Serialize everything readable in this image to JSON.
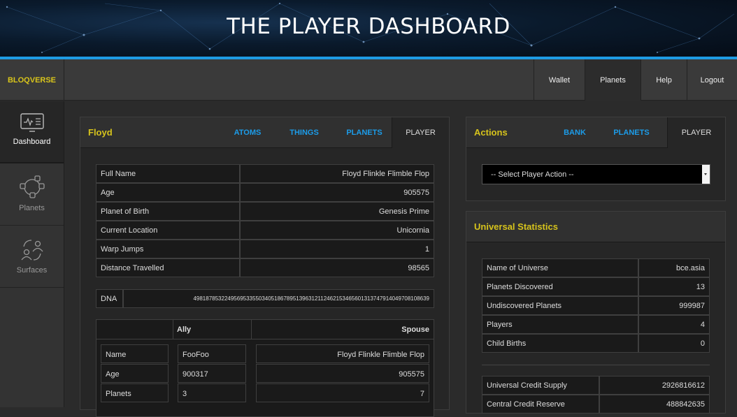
{
  "banner": {
    "title": "THE PLAYER DASHBOARD"
  },
  "nav": {
    "brand": "BLOQVERSE",
    "links": [
      {
        "label": "Wallet"
      },
      {
        "label": "Planets"
      },
      {
        "label": "Help"
      },
      {
        "label": "Logout"
      }
    ],
    "active": "Planets"
  },
  "sidebar": {
    "items": [
      {
        "label": "Dashboard",
        "icon": "monitor-icon"
      },
      {
        "label": "Planets",
        "icon": "network-icon"
      },
      {
        "label": "Surfaces",
        "icon": "people-exchange-icon"
      }
    ]
  },
  "player_panel": {
    "title": "Floyd",
    "tabs": [
      "ATOMS",
      "THINGS",
      "PLANETS",
      "PLAYER"
    ],
    "active_tab": "PLAYER",
    "details": [
      {
        "label": "Full Name",
        "value": "Floyd Flinkle Flimble Flop"
      },
      {
        "label": "Age",
        "value": "905575"
      },
      {
        "label": "Planet of Birth",
        "value": "Genesis Prime"
      },
      {
        "label": "Current Location",
        "value": "Unicornia"
      },
      {
        "label": "Warp Jumps",
        "value": "1"
      },
      {
        "label": "Distance Travelled",
        "value": "98565"
      }
    ],
    "dna": {
      "label": "DNA",
      "value": "498187853224956953355034051867895139631211246215346560131374791404970810863​9"
    },
    "relations": {
      "headers": [
        "",
        "Ally",
        "Spouse"
      ],
      "rows": [
        {
          "label": "Name",
          "ally": "FooFoo",
          "spouse": "Floyd Flinkle Flimble Flop"
        },
        {
          "label": "Age",
          "ally": "900317",
          "spouse": "905575"
        },
        {
          "label": "Planets",
          "ally": "3",
          "spouse": "7"
        }
      ]
    }
  },
  "actions_panel": {
    "title": "Actions",
    "tabs": [
      "BANK",
      "PLANETS",
      "PLAYER"
    ],
    "active_tab": "PLAYER",
    "select_value": "-- Select Player Action --"
  },
  "stats_panel": {
    "title": "Universal Statistics",
    "universe": [
      {
        "label": "Name of Universe",
        "value": "bce.asia"
      },
      {
        "label": "Planets Discovered",
        "value": "13"
      },
      {
        "label": "Undiscovered Planets",
        "value": "999987"
      },
      {
        "label": "Players",
        "value": "4"
      },
      {
        "label": "Child Births",
        "value": "0"
      }
    ],
    "credits": [
      {
        "label": "Universal Credit Supply",
        "value": "2926816612"
      },
      {
        "label": "Central Credit Reserve",
        "value": "488842635"
      }
    ]
  },
  "colors": {
    "accent_yellow": "#d6c31c",
    "tab_blue": "#1c9ce9",
    "banner_line": "#1e9be3"
  }
}
